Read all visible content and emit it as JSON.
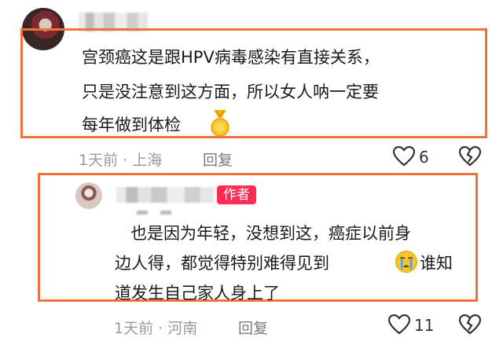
{
  "top_comment": {
    "text_lines": [
      "宫颈癌这是跟HPV病毒感染有直接关系，",
      "只是没注意到这方面，所以女人呐一定要",
      "每年做到体检"
    ],
    "time_location": "1天前 · 上海",
    "reply_label": "回复",
    "like_count": "6"
  },
  "reply_comment": {
    "author_badge": "作者",
    "text_lines": [
      "也是因为年轻，没想到这，癌症以前身",
      "边人得，都觉得特别难得见到",
      "谁知",
      "道发生自己家人身上了"
    ],
    "time_location": "1天前 · 河南",
    "reply_label": "回复",
    "like_count": "11"
  },
  "colors": {
    "highlight_border": "#f0733a",
    "author_badge_bg": "#fe2c55"
  },
  "icons": [
    "heart-icon",
    "broken-heart-icon",
    "gold-medal-emoji",
    "crying-emoji"
  ]
}
